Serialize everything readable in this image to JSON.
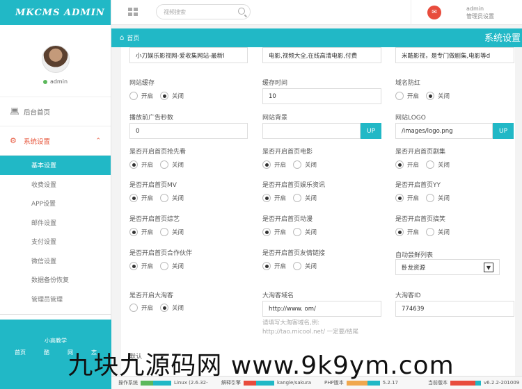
{
  "app": {
    "logo": "MKCMS ADMIN"
  },
  "user": {
    "name": "admin",
    "role": "管理员设置"
  },
  "search": {
    "placeholder": "视频搜索"
  },
  "breadcrumb": {
    "home": "首页",
    "page_title": "系统设置"
  },
  "sidebar": {
    "nav": [
      {
        "label": "后台首页",
        "icon": "laptop-icon"
      },
      {
        "label": "系统设置",
        "icon": "settings-icon",
        "active": true
      }
    ],
    "sub_items": [
      "基本设置",
      "收费设置",
      "APP设置",
      "邮件设置",
      "支付设置",
      "微信设置",
      "数据备份恢复",
      "管理员管理"
    ],
    "footer": {
      "title": "小高教学",
      "links": [
        "首页",
        "酷",
        "网",
        "志"
      ]
    }
  },
  "form": {
    "radio_on": "开启",
    "radio_off": "关闭",
    "upload_label": "UP",
    "top_inputs": [
      "小刀娱乐影视网-爱收集网站-最新l",
      "电影,视频大全,在线高清电影,付费",
      "米酷影视，是专门做剧集,电影等d"
    ],
    "cache_label": "网站缓存",
    "cache_time_label": "缓存时间",
    "cache_time_value": "10",
    "anti_red_label": "域名防红",
    "ad_seconds_label": "播放前广告秒数",
    "ad_seconds_value": "0",
    "bg_label": "网站背景",
    "bg_value": "",
    "logo_label": "网站LOGO",
    "logo_value": "/images/logo.png",
    "toggles": [
      "是否开启首页抢先看",
      "是否开启首页电影",
      "是否开启首页剧集",
      "是否开启首页MV",
      "是否开启首页娱乐资讯",
      "是否开启首页YY",
      "是否开启首页综艺",
      "是否开启首页动漫",
      "是否开启首页搞笑",
      "是否开启首页合作伙伴",
      "是否开启首页友情链接"
    ],
    "auto_list_label": "自动尝鲜列表",
    "auto_list_value": "卧龙资源",
    "taoke_label": "是否开启大淘客",
    "taoke_domain_label": "大淘客域名",
    "taoke_domain_value": "http://www.            om/",
    "taoke_id_label": "大淘客ID",
    "taoke_id_value": "774639",
    "taoke_hint": "请填写大淘客域名,例:\nhttp://tao.micool.net/ 一定要/结尾",
    "bottom_label": "默认"
  },
  "status_bar": [
    {
      "label": "操作系统",
      "value": "Linux (2.6.32-"
    },
    {
      "label": "解释引擎",
      "value": "kangle/sakura"
    },
    {
      "label": "PHP版本",
      "value": "5.2.17"
    },
    {
      "label": "当前版本",
      "value": "v6.2.2-201009"
    }
  ],
  "watermark": "九块九源码网 www.9k9ym.com"
}
